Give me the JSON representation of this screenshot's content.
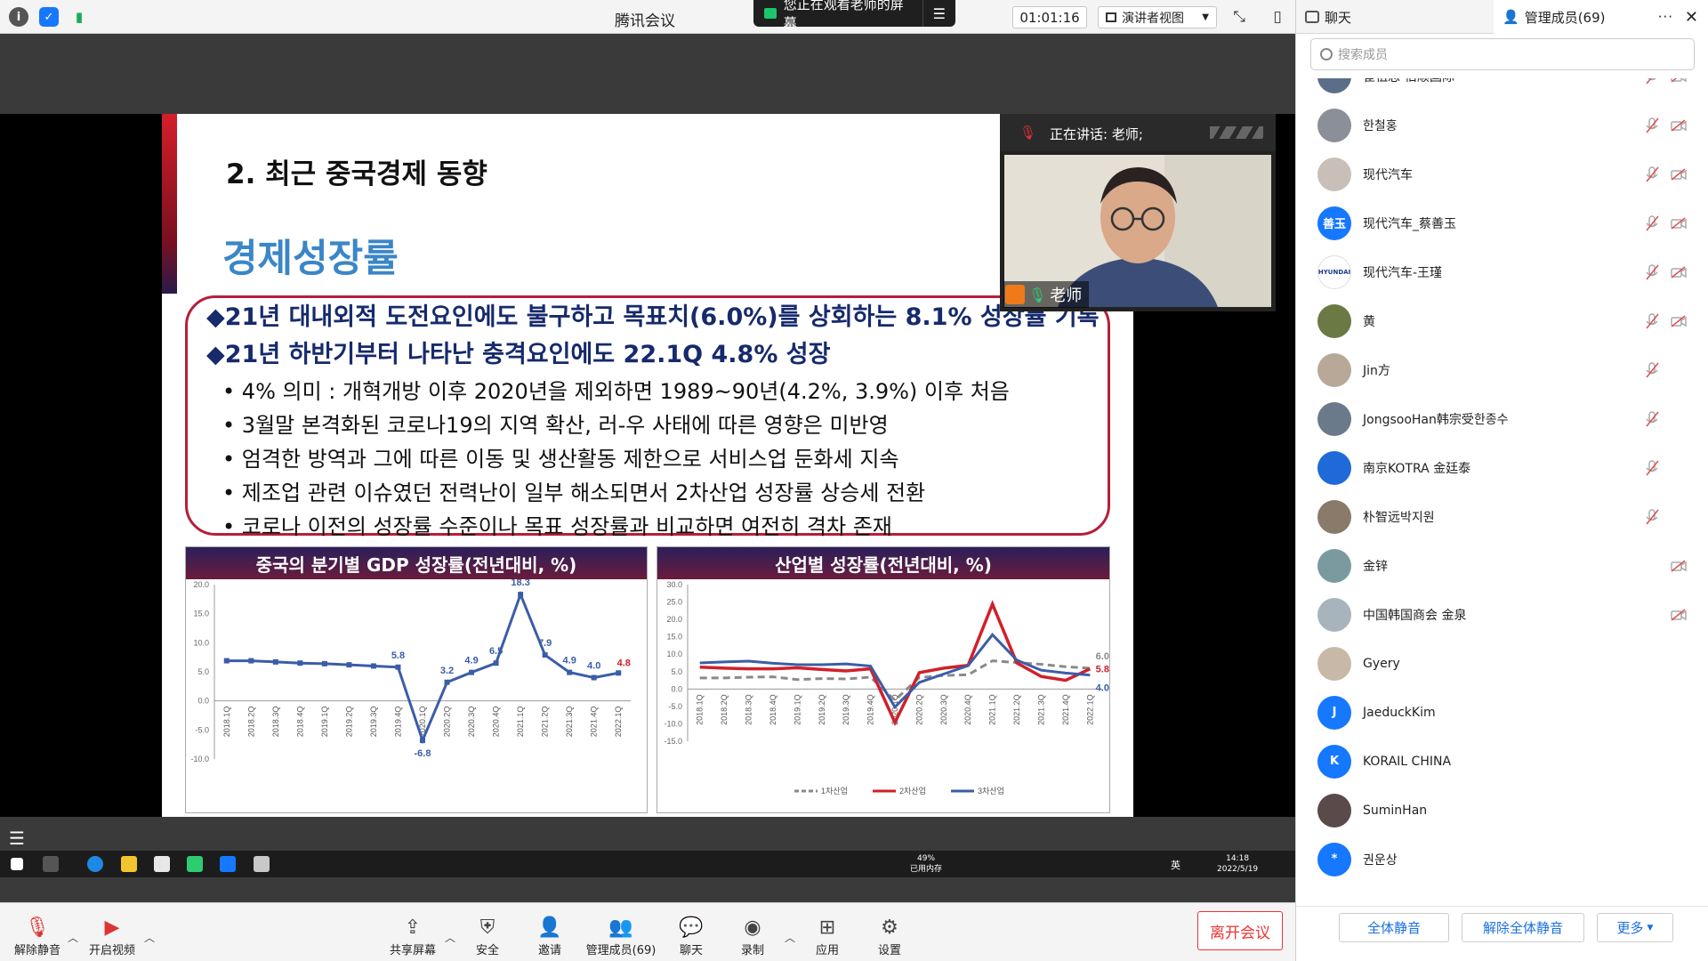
{
  "topbar": {
    "app_title": "腾讯会议",
    "watching_banner": "您正在观看老师的屏幕",
    "timer": "01:01:16",
    "view_mode": "演讲者视图"
  },
  "right_panel": {
    "chat_tab": "聊天",
    "members_tab": "管理成员(69)",
    "search_placeholder": "搜索成员",
    "members": [
      {
        "name": "崔祖忠-佰顺国际",
        "avatar_color": "#5a6e8a",
        "avatar_text": "",
        "mic_muted": true,
        "cam_off": true
      },
      {
        "name": "한철홍",
        "avatar_color": "#8a8f98",
        "avatar_text": "",
        "mic_muted": true,
        "cam_off": true
      },
      {
        "name": "现代汽车",
        "avatar_color": "#c8c0b8",
        "avatar_text": "",
        "mic_muted": true,
        "cam_off": true
      },
      {
        "name": "现代汽车_蔡善玉",
        "avatar_color": "#1677ff",
        "avatar_text": "善玉",
        "mic_muted": true,
        "cam_off": true
      },
      {
        "name": "现代汽车-王瑾",
        "avatar_color": "#ffffff",
        "avatar_text": "HYUNDAI",
        "mic_muted": true,
        "cam_off": true
      },
      {
        "name": "黄",
        "avatar_color": "#6b7a45",
        "avatar_text": "",
        "mic_muted": true,
        "cam_off": true
      },
      {
        "name": "Jin方",
        "avatar_color": "#b8a898",
        "avatar_text": "",
        "mic_muted": true,
        "cam_off": false
      },
      {
        "name": "JongsooHan韩宗受한종수",
        "avatar_color": "#6a7a8a",
        "avatar_text": "",
        "mic_muted": true,
        "cam_off": false
      },
      {
        "name": "南京KOTRA 金廷泰",
        "avatar_color": "#1f6ad8",
        "avatar_text": "",
        "mic_muted": true,
        "cam_off": false
      },
      {
        "name": "朴智远박지원",
        "avatar_color": "#8a7a6a",
        "avatar_text": "",
        "mic_muted": true,
        "cam_off": false
      },
      {
        "name": "金锌",
        "avatar_color": "#7a9aa0",
        "avatar_text": "",
        "mic_muted": false,
        "cam_off": true
      },
      {
        "name": "中国韩国商会 金泉",
        "avatar_color": "#a8b4bc",
        "avatar_text": "",
        "mic_muted": false,
        "cam_off": true
      },
      {
        "name": "Gyery",
        "avatar_color": "#c8b8a8",
        "avatar_text": "",
        "mic_muted": false,
        "cam_off": false
      },
      {
        "name": "JaeduckKim",
        "avatar_color": "#1677ff",
        "avatar_text": "J",
        "mic_muted": false,
        "cam_off": false
      },
      {
        "name": "KORAIL CHINA",
        "avatar_color": "#1677ff",
        "avatar_text": "K",
        "mic_muted": false,
        "cam_off": false
      },
      {
        "name": "SuminHan",
        "avatar_color": "#5a4a4a",
        "avatar_text": "",
        "mic_muted": false,
        "cam_off": false
      },
      {
        "name": "권운상",
        "avatar_color": "#1677ff",
        "avatar_text": "*",
        "mic_muted": false,
        "cam_off": false
      }
    ],
    "mute_all": "全体静音",
    "unmute_all": "解除全体静音",
    "more": "更多"
  },
  "video_tile": {
    "speaking": "正在讲话: 老师;",
    "name": "老师"
  },
  "slide": {
    "heading": "2. 최근 중국경제 동향",
    "subheading": "경제성장률",
    "bullets_main": [
      "21년 대내외적 도전요인에도 불구하고 목표치(6.0%)를 상회하는 8.1% 성장률 기록",
      "21년 하반기부터 나타난 충격요인에도 22.1Q 4.8% 성장"
    ],
    "bullets_sub": [
      "4% 의미 : 개혁개방 이후 2020년을 제외하면 1989~90년(4.2%, 3.9%) 이후 처음",
      "3월말 본격화된 코로나19의 지역 확산, 러-우 사태에 따른 영향은 미반영",
      "엄격한 방역과 그에 따른 이동 및 생산활동 제한으로 서비스업 둔화세 지속",
      "제조업 관련 이슈였던 전력난이 일부 해소되면서 2차산업 성장률 상승세 전환",
      "코로나 이전의 성장률 수준이나 목표 성장률과 비교하면 여전히 격차 존재"
    ]
  },
  "chart_data": [
    {
      "type": "line",
      "title": "중국의 분기별 GDP 성장률(전년대비, %)",
      "categories": [
        "2018.1Q",
        "2018.2Q",
        "2018.3Q",
        "2018.4Q",
        "2019.1Q",
        "2019.2Q",
        "2019.3Q",
        "2019.4Q",
        "2020.1Q",
        "2020.2Q",
        "2020.3Q",
        "2020.4Q",
        "2021.1Q",
        "2021.2Q",
        "2021.3Q",
        "2021.4Q",
        "2022.1Q"
      ],
      "series": [
        {
          "values": [
            6.9,
            6.9,
            6.7,
            6.5,
            6.4,
            6.2,
            6.0,
            5.8,
            -6.8,
            3.2,
            4.9,
            6.5,
            18.3,
            7.9,
            4.9,
            4.0,
            4.8
          ],
          "color": "#3b5da8"
        }
      ],
      "data_labels": [
        {
          "index": 7,
          "text": "5.8"
        },
        {
          "index": 8,
          "text": "-6.8"
        },
        {
          "index": 9,
          "text": "3.2"
        },
        {
          "index": 10,
          "text": "4.9"
        },
        {
          "index": 11,
          "text": "6.5"
        },
        {
          "index": 12,
          "text": "18.3"
        },
        {
          "index": 13,
          "text": "7.9"
        },
        {
          "index": 14,
          "text": "4.9"
        },
        {
          "index": 15,
          "text": "4.0"
        },
        {
          "index": 16,
          "text": "4.8"
        }
      ],
      "ylim": [
        -10,
        20
      ],
      "yticks": [
        "20.0",
        "15.0",
        "10.0",
        "5.0",
        "0.0",
        "-5.0",
        "-10.0"
      ],
      "last_label_color": "#d0202a"
    },
    {
      "type": "line",
      "title": "산업별 성장률(전년대비, %)",
      "categories": [
        "2018.1Q",
        "2018.2Q",
        "2018.3Q",
        "2018.4Q",
        "2019.1Q",
        "2019.2Q",
        "2019.3Q",
        "2019.4Q",
        "2020.1Q",
        "2020.2Q",
        "2020.3Q",
        "2020.4Q",
        "2021.1Q",
        "2021.2Q",
        "2021.3Q",
        "2021.4Q",
        "2022.1Q"
      ],
      "series": [
        {
          "name": "1차산업",
          "values": [
            3.2,
            3.2,
            3.4,
            3.5,
            2.7,
            3.0,
            2.9,
            3.4,
            -3.2,
            3.3,
            3.9,
            4.1,
            8.1,
            7.6,
            7.1,
            6.4,
            6.0
          ],
          "color": "#8a8a8a",
          "dash": true
        },
        {
          "name": "2차산업",
          "values": [
            6.3,
            6.0,
            5.8,
            5.8,
            6.1,
            5.6,
            5.2,
            5.8,
            -9.6,
            4.7,
            6.0,
            6.8,
            24.4,
            7.5,
            3.6,
            2.5,
            5.8
          ],
          "color": "#d0202a"
        },
        {
          "name": "3차산업",
          "values": [
            7.5,
            7.8,
            8.0,
            7.4,
            7.0,
            7.0,
            7.2,
            6.6,
            -5.2,
            1.9,
            4.3,
            6.7,
            15.6,
            8.3,
            5.4,
            4.6,
            4.0
          ],
          "color": "#3b5da8"
        }
      ],
      "data_labels": [
        {
          "series": 0,
          "index": 16,
          "text": "6.0"
        },
        {
          "series": 1,
          "index": 16,
          "text": "5.8"
        },
        {
          "series": 2,
          "index": 16,
          "text": "4.0"
        }
      ],
      "ylim": [
        -15,
        30
      ],
      "yticks": [
        "30.0",
        "25.0",
        "20.0",
        "15.0",
        "10.0",
        "5.0",
        "0.0",
        "-5.0",
        "-10.0",
        "-15.0"
      ]
    }
  ],
  "taskbar": {
    "mem_percent": "49%",
    "mem_label": "已用内存",
    "lang": "英",
    "time": "14:18",
    "date": "2022/5/19"
  },
  "bottombar": {
    "unmute": "解除静音",
    "start_video": "开启视频",
    "share_screen": "共享屏幕",
    "security": "安全",
    "invite": "邀请",
    "members": "管理成员(69)",
    "chat": "聊天",
    "record": "录制",
    "apps": "应用",
    "settings": "设置",
    "leave": "离开会议"
  }
}
